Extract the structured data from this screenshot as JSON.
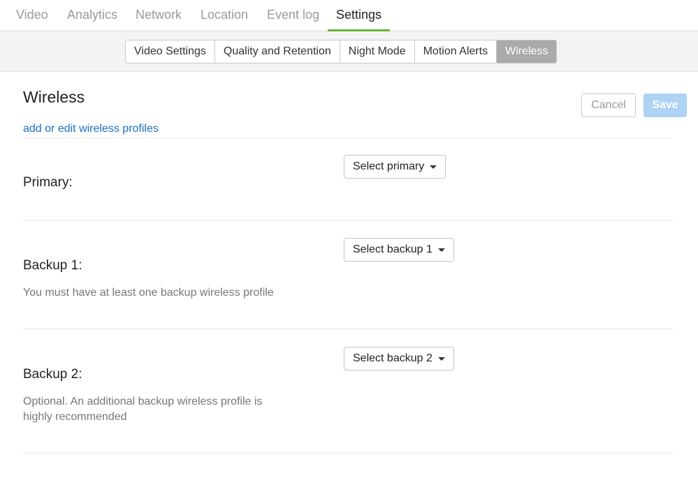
{
  "top_tabs": [
    {
      "label": "Video"
    },
    {
      "label": "Analytics"
    },
    {
      "label": "Network"
    },
    {
      "label": "Location"
    },
    {
      "label": "Event log"
    },
    {
      "label": "Settings"
    }
  ],
  "active_top_tab": "Settings",
  "sub_tabs": [
    {
      "label": "Video Settings"
    },
    {
      "label": "Quality and Retention"
    },
    {
      "label": "Night Mode"
    },
    {
      "label": "Motion Alerts"
    },
    {
      "label": "Wireless"
    }
  ],
  "active_sub_tab": "Wireless",
  "header": {
    "title": "Wireless",
    "edit_link": "add or edit wireless profiles",
    "cancel_label": "Cancel",
    "save_label": "Save"
  },
  "rows": [
    {
      "label": "Primary:",
      "dropdown": "Select primary",
      "help": ""
    },
    {
      "label": "Backup 1:",
      "dropdown": "Select backup 1",
      "help": "You must have at least one backup wireless profile"
    },
    {
      "label": "Backup 2:",
      "dropdown": "Select backup 2",
      "help": "Optional. An additional backup wireless profile is highly recommended"
    }
  ],
  "colors": {
    "accent_green": "#6ab03a",
    "link_blue": "#1a6fc7",
    "save_disabled": "#aed3f5",
    "active_subtab": "#aaaaaa"
  }
}
